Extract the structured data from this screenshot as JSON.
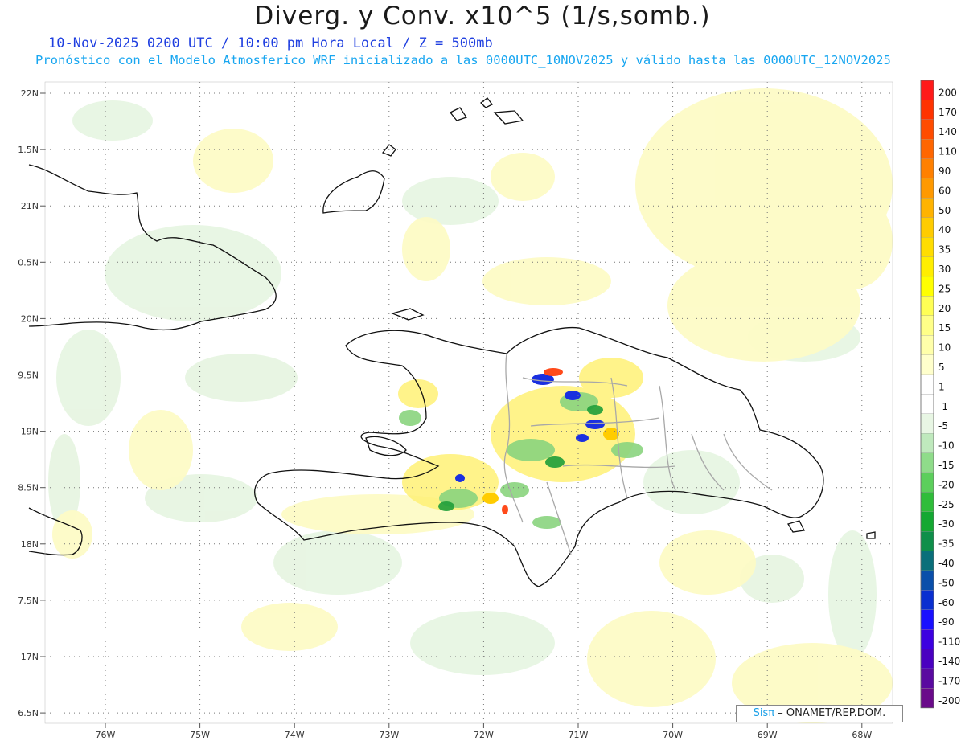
{
  "header": {
    "title": "Diverg. y Conv. x10^5 (1/s,somb.)",
    "subtitle": "10-Nov-2025  0200 UTC / 10:00 pm Hora Local / Z = 500mb",
    "description": "Pronóstico con el Modelo Atmosferico WRF inicializado a las 0000UTC_10NOV2025 y válido hasta las  0000UTC_12NOV2025"
  },
  "lat_labels": [
    "22N",
    "1.5N",
    "21N",
    "0.5N",
    "20N",
    "9.5N",
    "19N",
    "8.5N",
    "18N",
    "7.5N",
    "17N",
    "6.5N"
  ],
  "lon_labels": [
    "76W",
    "75W",
    "74W",
    "73W",
    "72W",
    "71W",
    "70W",
    "69W",
    "68W"
  ],
  "colorbar": {
    "labels": [
      "200",
      "170",
      "140",
      "110",
      "90",
      "60",
      "50",
      "40",
      "35",
      "30",
      "25",
      "20",
      "15",
      "10",
      "5",
      "1",
      "-1",
      "-5",
      "-10",
      "-15",
      "-20",
      "-25",
      "-30",
      "-35",
      "-40",
      "-50",
      "-60",
      "-90",
      "-110",
      "-140",
      "-170",
      "-200"
    ],
    "colors": [
      "#ff1a1a",
      "#ff3300",
      "#ff4c00",
      "#ff6600",
      "#ff8000",
      "#ff9900",
      "#ffb300",
      "#ffcc00",
      "#ffdd00",
      "#ffee00",
      "#ffff00",
      "#ffff55",
      "#ffff88",
      "#ffffaa",
      "#ffffcc",
      "#ffffff",
      "#ffffff",
      "#e8f6e4",
      "#bfe9bd",
      "#8fdc8a",
      "#5ccf5c",
      "#2fbd3a",
      "#14a832",
      "#0f8f4a",
      "#0a6f7a",
      "#0a4faa",
      "#0a2fd0",
      "#1a10ff",
      "#3d00e0",
      "#4a00c0",
      "#5a0aa0",
      "#6a0a8a"
    ]
  },
  "credit": {
    "brand": "Sisπ",
    "org": "– ONAMET/REP.DOM."
  }
}
